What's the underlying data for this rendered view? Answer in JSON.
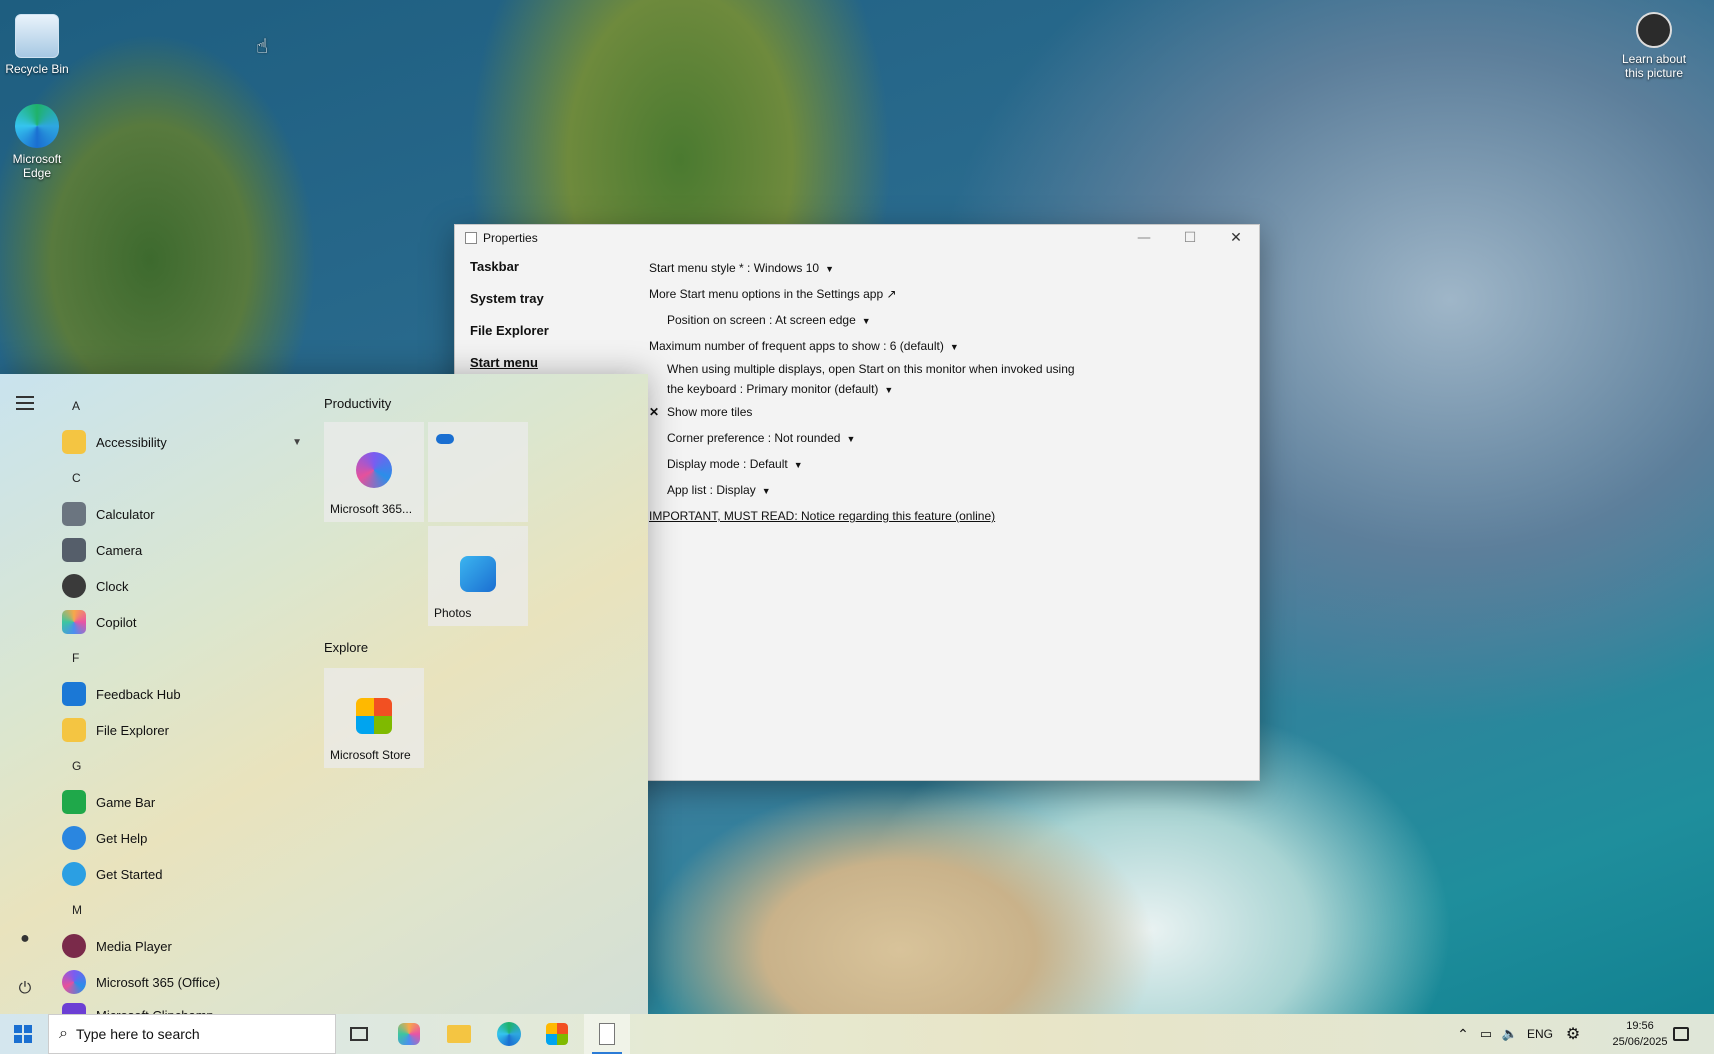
{
  "desktop": {
    "recycle_bin": "Recycle Bin",
    "edge": "Microsoft Edge",
    "learn": "Learn about this picture"
  },
  "window": {
    "title": "Properties",
    "nav": [
      "Taskbar",
      "System tray",
      "File Explorer",
      "Start menu"
    ],
    "settings": {
      "style": "Start menu style * : Windows 10",
      "more_options": "More Start menu options in the Settings app ↗",
      "position": "Position on screen : At screen edge",
      "max_apps": "Maximum number of frequent apps to show : 6 (default)",
      "multi_display_1": "When using multiple displays, open Start on this monitor when invoked using",
      "multi_display_2": "the keyboard : Primary monitor (default)",
      "show_more_tiles": "Show more tiles",
      "corner": "Corner preference : Not rounded",
      "display_mode": "Display mode : Default",
      "app_list": "App list : Display",
      "notice": "IMPORTANT, MUST READ: Notice regarding this feature (online)"
    }
  },
  "start": {
    "letters": {
      "a": "A",
      "c": "C",
      "f": "F",
      "g": "G",
      "m": "M"
    },
    "apps": {
      "accessibility": "Accessibility",
      "calculator": "Calculator",
      "camera": "Camera",
      "clock": "Clock",
      "copilot": "Copilot",
      "feedback": "Feedback Hub",
      "explorer": "File Explorer",
      "gamebar": "Game Bar",
      "gethelp": "Get Help",
      "getstarted": "Get Started",
      "media": "Media Player",
      "m365": "Microsoft 365 (Office)",
      "clipchamp": "Microsoft Clipchamp"
    },
    "groups": {
      "productivity": "Productivity",
      "explore": "Explore"
    },
    "tiles": {
      "m365": "Microsoft 365...",
      "photos": "Photos",
      "store": "Microsoft Store"
    }
  },
  "taskbar": {
    "search_placeholder": "Type here to search",
    "lang": "ENG",
    "time": "19:56",
    "date": "25/06/2025"
  }
}
